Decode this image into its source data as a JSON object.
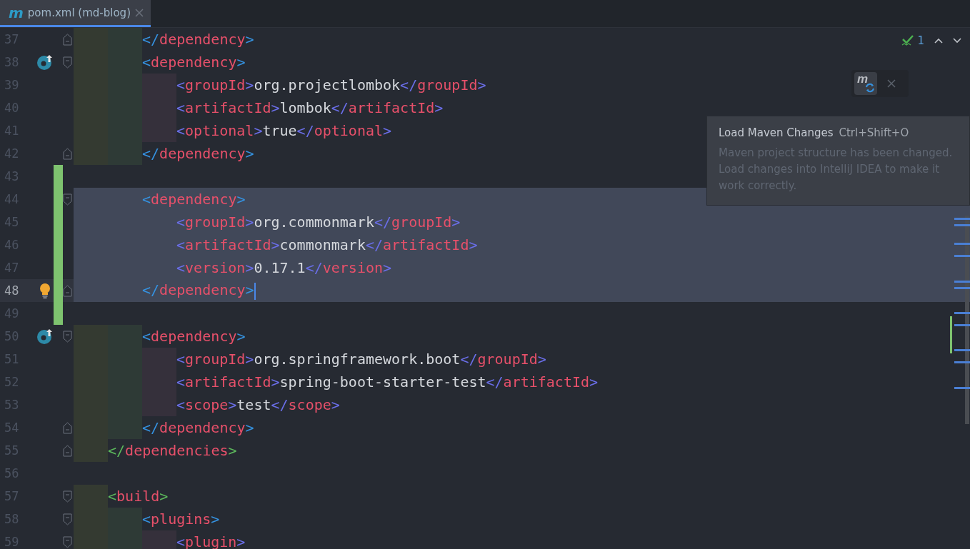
{
  "tab": {
    "icon": "m",
    "title": "pom.xml (md-blog)",
    "selected": true
  },
  "inspections": {
    "count": "1"
  },
  "maven_button": {
    "icon": "m"
  },
  "tooltip": {
    "title": "Load Maven Changes",
    "shortcut": "Ctrl+Shift+O",
    "description": "Maven project structure has been changed. Load changes into IntelliJ IDEA to make it work correctly."
  },
  "lines": [
    {
      "number": "37",
      "text": "        </dependency>",
      "color": "#3592e0",
      "fold_marker": {
        "kind": "end"
      },
      "changed": false,
      "selected": false
    },
    {
      "number": "38",
      "text": "        <dependency>",
      "color": "#3592e0",
      "fold_marker": {
        "kind": "start"
      },
      "gutter_icon": {
        "kind": "override"
      },
      "changed": false,
      "selected": false
    },
    {
      "number": "39",
      "text": "            <groupId>org.projectlombok</groupId>",
      "color": "#6a6ee8",
      "changed": false,
      "selected": false
    },
    {
      "number": "40",
      "text": "            <artifactId>lombok</artifactId>",
      "color": "#6a6ee8",
      "changed": false,
      "selected": false
    },
    {
      "number": "41",
      "text": "            <optional>true</optional>",
      "color": "#6a6ee8",
      "changed": false,
      "selected": false
    },
    {
      "number": "42",
      "text": "        </dependency>",
      "color": "#3592e0",
      "fold_marker": {
        "kind": "end"
      },
      "changed": false,
      "selected": false
    },
    {
      "number": "43",
      "changed": true,
      "selected": false
    },
    {
      "number": "44",
      "text": "        <dependency>",
      "color": "#3592e0",
      "fold_marker": {
        "kind": "start"
      },
      "changed": true,
      "selected": true
    },
    {
      "number": "45",
      "text": "            <groupId>org.commonmark</groupId>",
      "color": "#6a6ee8",
      "changed": true,
      "selected": true
    },
    {
      "number": "46",
      "text": "            <artifactId>commonmark</artifactId>",
      "color": "#6a6ee8",
      "changed": true,
      "selected": true
    },
    {
      "number": "47",
      "text": "            <version>0.17.1</version>",
      "color": "#6a6ee8",
      "changed": true,
      "selected": true
    },
    {
      "number": "48",
      "text": "        </dependency>",
      "color": "#3592e0",
      "fold_marker": {
        "kind": "end"
      },
      "gutter_icon": {
        "kind": "bulb"
      },
      "changed": true,
      "selected": true,
      "current": true
    },
    {
      "number": "49",
      "changed": true,
      "selected": false
    },
    {
      "number": "50",
      "text": "        <dependency>",
      "color": "#3592e0",
      "fold_marker": {
        "kind": "start"
      },
      "gutter_icon": {
        "kind": "override"
      },
      "changed": false,
      "selected": false
    },
    {
      "number": "51",
      "text": "            <groupId>org.springframework.boot</groupId>",
      "color": "#6a6ee8",
      "changed": false,
      "selected": false
    },
    {
      "number": "52",
      "text": "            <artifactId>spring-boot-starter-test</artifactId>",
      "color": "#6a6ee8",
      "changed": false,
      "selected": false
    },
    {
      "number": "53",
      "text": "            <scope>test</scope>",
      "color": "#6a6ee8",
      "changed": false,
      "selected": false
    },
    {
      "number": "54",
      "text": "        </dependency>",
      "color": "#3592e0",
      "fold_marker": {
        "kind": "end"
      },
      "changed": false,
      "selected": false
    },
    {
      "number": "55",
      "text": "    </dependencies>",
      "color": "#5cb85c",
      "fold_marker": {
        "kind": "end"
      },
      "changed": false,
      "selected": false
    },
    {
      "number": "56",
      "changed": false,
      "selected": false
    },
    {
      "number": "57",
      "text": "    <build>",
      "color": "#5cb85c",
      "fold_marker": {
        "kind": "start"
      },
      "changed": false,
      "selected": false
    },
    {
      "number": "58",
      "text": "        <plugins>",
      "color": "#3592e0",
      "fold_marker": {
        "kind": "start"
      },
      "changed": false,
      "selected": false
    },
    {
      "number": "59",
      "text": "            <plugin>",
      "color": "#6a6ee8",
      "fold_marker": {
        "kind": "start"
      },
      "changed": false,
      "selected": false
    }
  ]
}
